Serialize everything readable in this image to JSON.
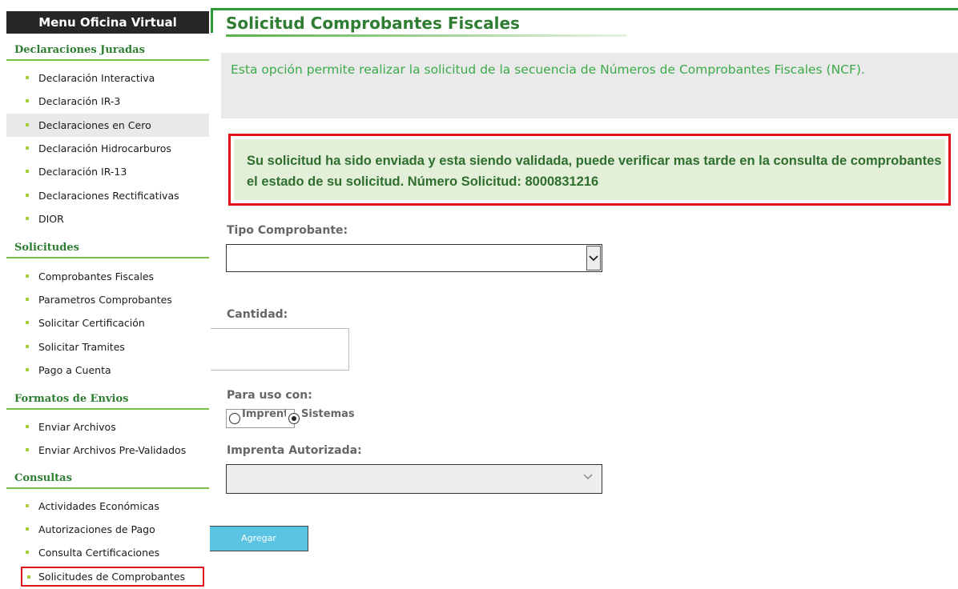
{
  "sidebar": {
    "title": "Menu Oficina Virtual",
    "sections": [
      {
        "header": "Declaraciones Juradas",
        "items": [
          "Declaración Interactiva",
          "Declaración IR-3",
          "Declaraciones en Cero",
          "Declaración Hidrocarburos",
          "Declaración IR-13",
          "Declaraciones Rectificativas",
          "DIOR"
        ]
      },
      {
        "header": "Solicitudes",
        "items": [
          "Comprobantes Fiscales",
          "Parametros Comprobantes",
          "Solicitar Certificación",
          "Solicitar Tramites",
          "Pago a Cuenta"
        ]
      },
      {
        "header": "Formatos de Envios",
        "items": [
          "Enviar Archivos",
          "Enviar Archivos Pre-Validados"
        ]
      },
      {
        "header": "Consultas",
        "items": [
          "Actividades Económicas",
          "Autorizaciones de Pago",
          "Consulta Certificaciones",
          "Solicitudes de Comprobantes"
        ]
      }
    ]
  },
  "main": {
    "title": "Solicitud Comprobantes Fiscales",
    "info": "Esta opción permite realizar la solicitud de la secuencia de Números de Comprobantes Fiscales (NCF).",
    "success": "Su solicitud ha sido enviada y esta siendo validada, puede verificar mas tarde en la consulta de comprobantes el estado de su solicitud. Número Solicitud: 8000831216",
    "tipo_label": "Tipo Comprobante:",
    "tipo_value": "",
    "cantidad_label": "Cantidad:",
    "cantidad_value": "",
    "uso_label": "Para uso con:",
    "radio_imprenta": "Imprenta",
    "radio_sistemas": "Sistemas",
    "selected_radio": "Sistemas",
    "imprenta_label": "Imprenta Autorizada:",
    "imprenta_value": "",
    "agregar_label": "Agregar"
  }
}
